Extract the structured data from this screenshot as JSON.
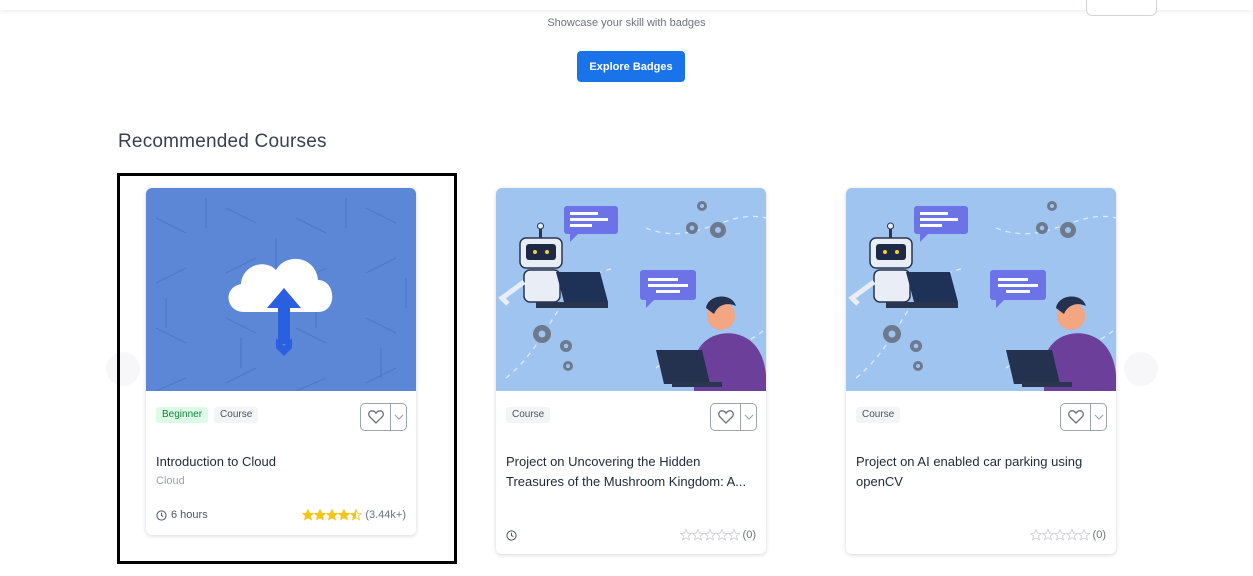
{
  "header": {
    "badge_subtitle": "Showcase your skill with badges",
    "explore_label": "Explore Badges"
  },
  "section": {
    "title": "Recommended Courses"
  },
  "colors": {
    "accent": "#1a73e8",
    "star": "#f5c518",
    "beginner_bg": "#dcfce7",
    "beginner_fg": "#15803d"
  },
  "courses": [
    {
      "tags": [
        "Beginner",
        "Course"
      ],
      "title": "Introduction to Cloud",
      "subtitle": "Cloud",
      "duration": "6 hours",
      "rating": 4.5,
      "rating_count": "(3.44k+)",
      "image": "cloud-upload-illustration"
    },
    {
      "tags": [
        "Course"
      ],
      "title": "Project on Uncovering the Hidden Treasures of the Mushroom Kingdom: A...",
      "duration": "",
      "rating": 0,
      "rating_count": "(0)",
      "image": "robot-and-person-illustration"
    },
    {
      "tags": [
        "Course"
      ],
      "title": "Project on AI enabled car parking using openCV",
      "duration": "",
      "rating": 0,
      "rating_count": "(0)",
      "image": "robot-and-person-illustration"
    }
  ]
}
